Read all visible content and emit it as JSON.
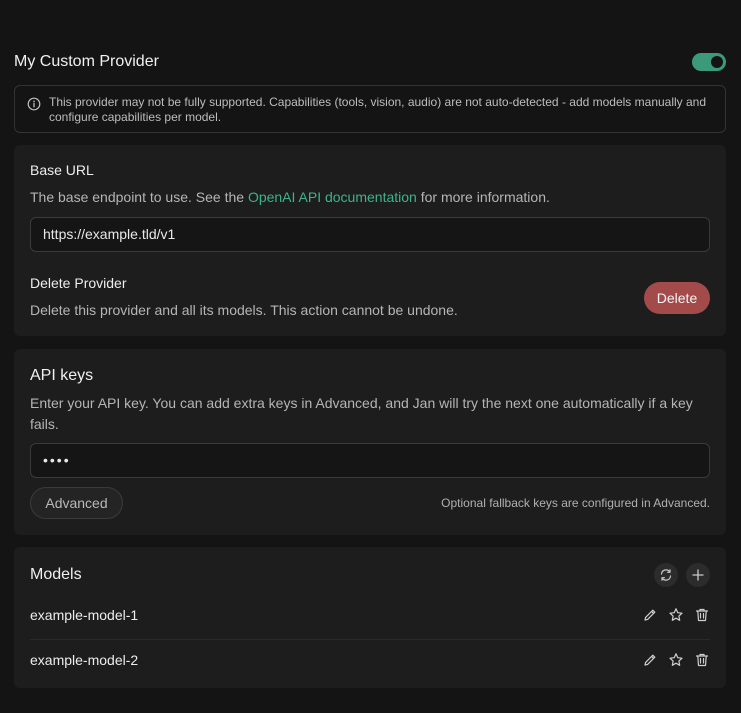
{
  "provider": {
    "title": "My Custom Provider",
    "enabled": true
  },
  "notice": {
    "text": "This provider may not be fully supported. Capabilities (tools, vision, audio) are not auto-detected - add models manually and configure capabilities per model."
  },
  "base_url": {
    "label": "Base URL",
    "desc_before": "The base endpoint to use. See the ",
    "link_text": "OpenAI API documentation",
    "desc_after": " for more information.",
    "value": "https://example.tld/v1"
  },
  "delete_provider": {
    "label": "Delete Provider",
    "desc": "Delete this provider and all its models. This action cannot be undone.",
    "button": "Delete"
  },
  "api_keys": {
    "title": "API keys",
    "desc": "Enter your API key. You can add extra keys in Advanced, and Jan will try the next one automatically if a key fails.",
    "value": "••••",
    "advanced_button": "Advanced",
    "hint": "Optional fallback keys are configured in Advanced."
  },
  "models": {
    "title": "Models",
    "items": [
      {
        "name": "example-model-1"
      },
      {
        "name": "example-model-2"
      }
    ]
  },
  "colors": {
    "accent": "#3fb28d",
    "danger": "#a34a4a",
    "background": "#141414",
    "card": "#1d1d1d"
  }
}
